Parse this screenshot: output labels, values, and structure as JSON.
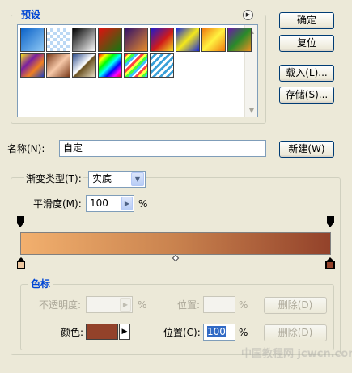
{
  "presets": {
    "title": "预设",
    "swatches": [
      {
        "id": "swatch-1",
        "name": "preset-foreground-to-background",
        "background": "linear-gradient(135deg,#0b62c8,#8ec8f4)"
      },
      {
        "id": "swatch-2",
        "name": "preset-foreground-to-transparent",
        "background": "repeating-conic-gradient(#bcd8f4 0% 25%, #ffffff 0% 50%) 0 0/8px 8px"
      },
      {
        "id": "swatch-3",
        "name": "preset-black-white",
        "background": "linear-gradient(135deg,#000000,#ffffff)"
      },
      {
        "id": "swatch-4",
        "name": "preset-red-green",
        "background": "linear-gradient(135deg,#e01010,#107a10)"
      },
      {
        "id": "swatch-5",
        "name": "preset-violet-orange",
        "background": "linear-gradient(135deg,#30106a,#e88c2a)"
      },
      {
        "id": "swatch-6",
        "name": "preset-blue-red-yellow",
        "background": "linear-gradient(135deg,#1a1ad0,#d01a1a 55%,#f4e020)"
      },
      {
        "id": "swatch-7",
        "name": "preset-blue-yellow-blue",
        "background": "linear-gradient(135deg,#1a2ad8,#f4e81a 50%,#1a2ad8)"
      },
      {
        "id": "swatch-8",
        "name": "preset-orange-yellow-orange",
        "background": "linear-gradient(135deg,#f07a10,#fff240 50%,#f07a10)"
      },
      {
        "id": "swatch-9",
        "name": "preset-violet-green-orange",
        "background": "linear-gradient(135deg,#6a1aa8,#2a8a2a 50%,#f09020)"
      },
      {
        "id": "swatch-10",
        "name": "preset-yellow-violet-orange-blue",
        "background": "linear-gradient(135deg,#f4e020,#7a20a0 35%,#f08020 65%,#2040c0)"
      },
      {
        "id": "swatch-11",
        "name": "preset-copper",
        "background": "linear-gradient(135deg,#7a3a1a,#f6c8a8 50%,#7a3a1a)"
      },
      {
        "id": "swatch-12",
        "name": "preset-chrome",
        "background": "linear-gradient(135deg,#2a4a8a,#ffffff 48%,#6a5020 52%,#e8e0c8)"
      },
      {
        "id": "swatch-13",
        "name": "preset-spectrum",
        "background": "linear-gradient(135deg,#ff0000,#ffff00,#00ff00,#00ffff,#0000ff,#ff00ff,#ff0000)"
      },
      {
        "id": "swatch-14",
        "name": "preset-transparent-rainbow",
        "background": "repeating-linear-gradient(135deg,#ff4040 0 3px,#ffff40 3px 6px,#40ff40 6px 9px,#40c0ff 9px 12px,#ffffff 12px 14px)"
      },
      {
        "id": "swatch-15",
        "name": "preset-transparent-stripes",
        "background": "repeating-linear-gradient(135deg,#ffffff 0 3px,#3aa0d8 3px 6px)"
      }
    ]
  },
  "buttons": {
    "ok": {
      "label": "确定"
    },
    "reset": {
      "label": "复位"
    },
    "load": {
      "label": "载入(L)..."
    },
    "save": {
      "label": "存储(S)..."
    },
    "new": {
      "label": "新建(W)"
    },
    "delete_opacity": {
      "label": "删除(D)"
    },
    "delete_color": {
      "label": "删除(D)"
    }
  },
  "name": {
    "label": "名称(N):",
    "value": "自定"
  },
  "gradient_type": {
    "label": "渐变类型(T):",
    "value": "实底"
  },
  "smoothness": {
    "label": "平滑度(M):",
    "value": "100",
    "unit": "%"
  },
  "gradient_bar": {
    "start_color": "#f2b06e",
    "mid_color": "#c9824e",
    "end_color": "#93422a"
  },
  "stops": {
    "title": "色标",
    "opacity_label": "不透明度:",
    "opacity_value": "",
    "opacity_unit": "%",
    "opacity_location_label": "位置:",
    "opacity_location_value": "",
    "opacity_location_unit": "%",
    "color_label": "颜色:",
    "color_value": "#93422a",
    "color_location_label": "位置(C):",
    "color_location_value": "100",
    "color_location_unit": "%",
    "left_color_stop": "#eec8a0",
    "right_color_stop": "#93422a"
  },
  "watermark": {
    "text": "中国教程网 jcwcn.com"
  }
}
